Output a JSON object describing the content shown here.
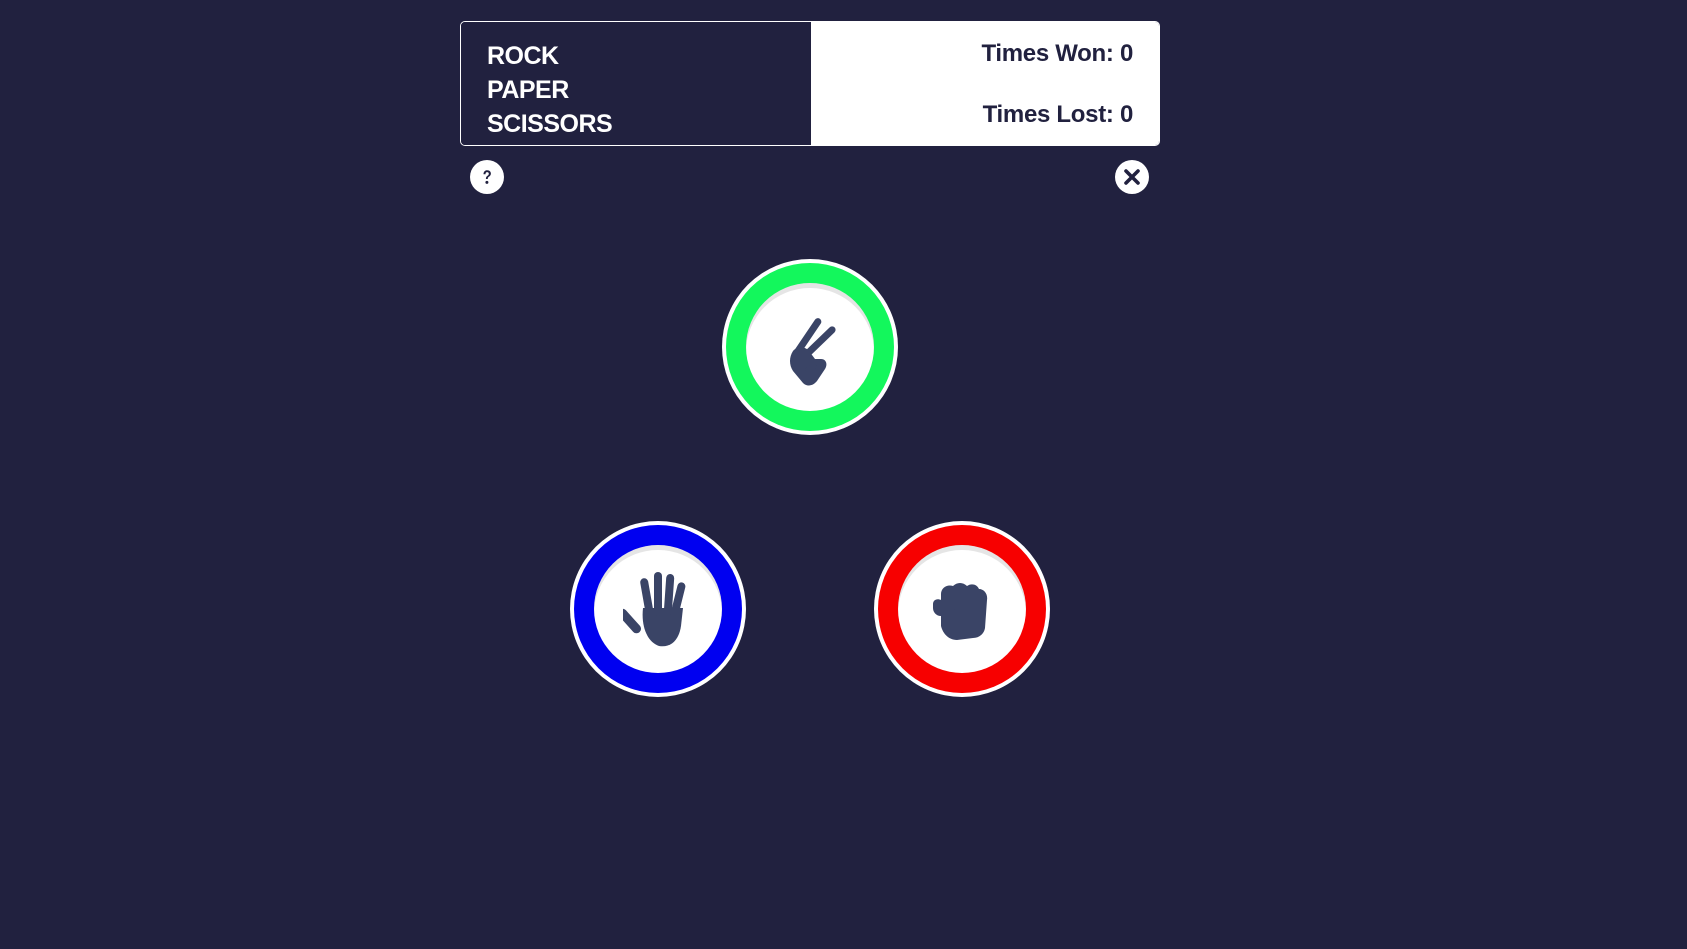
{
  "header": {
    "title_lines": [
      "ROCK",
      "PAPER",
      "SCISSORS"
    ],
    "times_won_label": "Times Won: 0",
    "times_lost_label": "Times Lost: 0"
  },
  "controls": {
    "help_icon": "question-circle-icon",
    "close_icon": "x-circle-icon"
  },
  "choices": [
    {
      "name": "scissors",
      "icon": "scissors-hand-icon",
      "color": "#13f75c"
    },
    {
      "name": "paper",
      "icon": "open-hand-icon",
      "color": "#0000f0"
    },
    {
      "name": "rock",
      "icon": "fist-icon",
      "color": "#f70000"
    }
  ],
  "colors": {
    "background": "#21213f",
    "icon_fill": "#3a4466",
    "panel_light": "#ffffff"
  }
}
